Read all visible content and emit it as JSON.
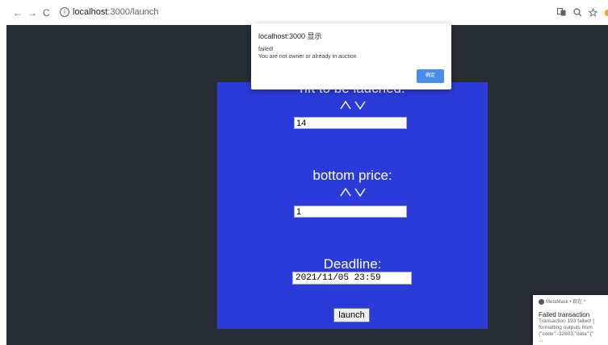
{
  "browser": {
    "back": "←",
    "forward": "→",
    "reload": "C",
    "url_host": "localhost",
    "url_path": ":3000/launch",
    "translate_icon": "translate-icon",
    "zoom_icon": "zoom-icon",
    "star_icon": "star-icon"
  },
  "form": {
    "nft_title": "nft to be lauched:",
    "nft_id_value": "14",
    "bottom_price_title": "bottom price:",
    "bottom_price_value": "1",
    "deadline_title": "Deadline:",
    "deadline_value": "2021/11/05 23:59",
    "launch_label": "launch"
  },
  "alert": {
    "origin": "localhost:3000 显示",
    "line1": "failed!",
    "line2": "You are not owner or already in auction",
    "ok_label": "确定"
  },
  "notification": {
    "app_name": "MetaMask • 现在 ^",
    "title": "Failed transaction",
    "line1": "Transaction 193 failed! [",
    "line2": "formatting outputs from",
    "line3": "{\"code\":-32603,\"data\":{\"",
    "line4": "..."
  },
  "colors": {
    "page_bg": "#282c34",
    "panel_bg": "#2b3bd9",
    "alert_button": "#4a8de6"
  }
}
